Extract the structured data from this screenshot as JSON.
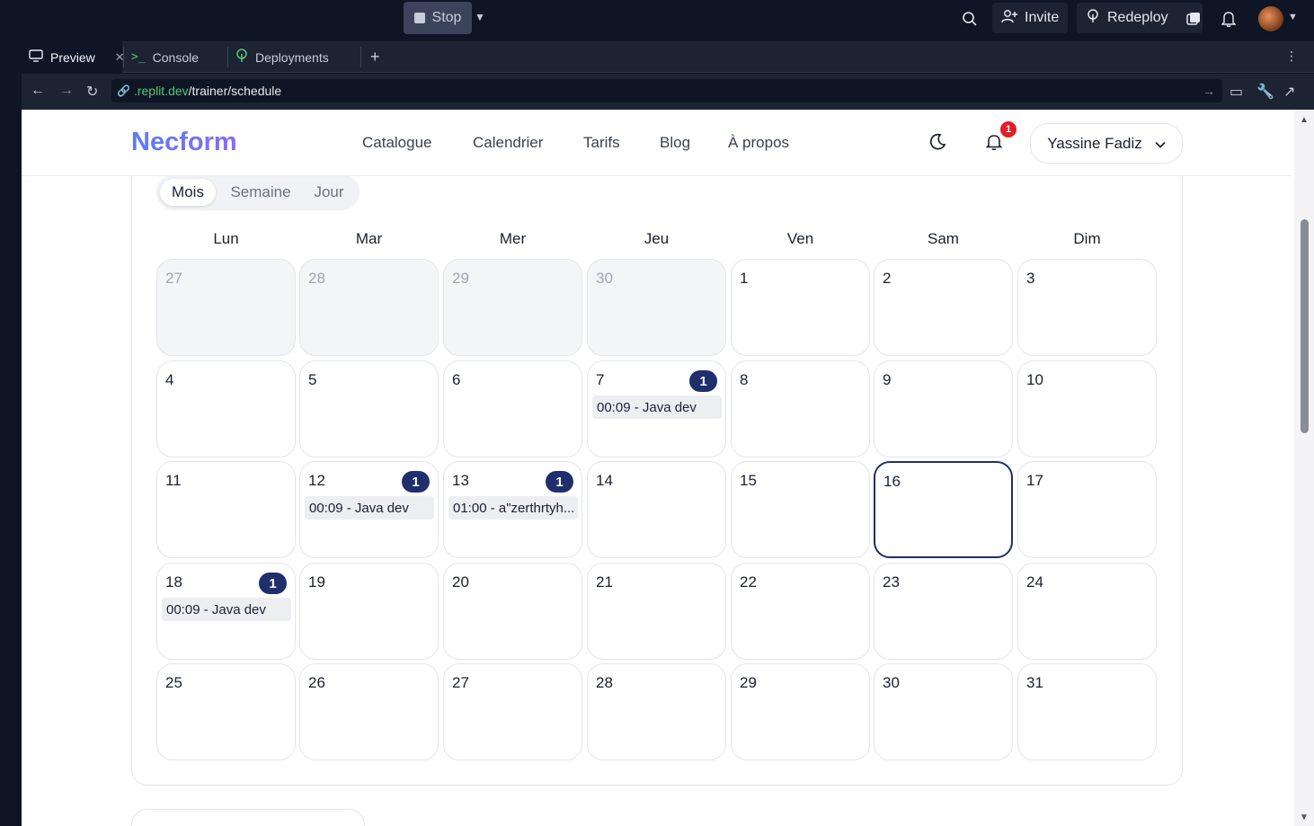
{
  "ide": {
    "stop_label": "Stop",
    "invite_label": "Invite",
    "redeploy_label": "Redeploy",
    "tabs": [
      {
        "label": "Preview",
        "icon": "monitor-icon"
      },
      {
        "label": "Console",
        "icon": "terminal-icon"
      },
      {
        "label": "Deployments",
        "icon": "deploy-tree-icon"
      }
    ],
    "add_tab": "+",
    "url_host": ".replit.dev",
    "url_path": "/trainer/schedule"
  },
  "site": {
    "logo": "Necform",
    "nav": [
      "Catalogue",
      "Calendrier",
      "Tarifs",
      "Blog",
      "À propos"
    ],
    "notification_count": "1",
    "user_name": "Yassine Fadiz"
  },
  "calendar": {
    "views": [
      "Mois",
      "Semaine",
      "Jour"
    ],
    "active_view": "Mois",
    "weekdays": [
      "Lun",
      "Mar",
      "Mer",
      "Jeu",
      "Ven",
      "Sam",
      "Dim"
    ],
    "weeks": [
      [
        {
          "d": "27",
          "other": true
        },
        {
          "d": "28",
          "other": true
        },
        {
          "d": "29",
          "other": true
        },
        {
          "d": "30",
          "other": true
        },
        {
          "d": "1"
        },
        {
          "d": "2"
        },
        {
          "d": "3"
        }
      ],
      [
        {
          "d": "4"
        },
        {
          "d": "5"
        },
        {
          "d": "6"
        },
        {
          "d": "7",
          "count": "1",
          "event": "00:09 - Java dev"
        },
        {
          "d": "8"
        },
        {
          "d": "9"
        },
        {
          "d": "10"
        }
      ],
      [
        {
          "d": "11"
        },
        {
          "d": "12",
          "count": "1",
          "event": "00:09 - Java dev"
        },
        {
          "d": "13",
          "count": "1",
          "event": "01:00 - a\"zerthrtyh..."
        },
        {
          "d": "14"
        },
        {
          "d": "15"
        },
        {
          "d": "16",
          "today": true
        },
        {
          "d": "17"
        }
      ],
      [
        {
          "d": "18",
          "count": "1",
          "event": "00:09 - Java dev"
        },
        {
          "d": "19"
        },
        {
          "d": "20"
        },
        {
          "d": "21"
        },
        {
          "d": "22"
        },
        {
          "d": "23"
        },
        {
          "d": "24"
        }
      ],
      [
        {
          "d": "25"
        },
        {
          "d": "26"
        },
        {
          "d": "27"
        },
        {
          "d": "28"
        },
        {
          "d": "29"
        },
        {
          "d": "30"
        },
        {
          "d": "31"
        }
      ]
    ]
  },
  "colors": {
    "accent_navy": "#1e2f6b",
    "notif_red": "#e11d2a",
    "logo_gradient": [
      "#5b7cf4",
      "#8a6cf2"
    ]
  }
}
